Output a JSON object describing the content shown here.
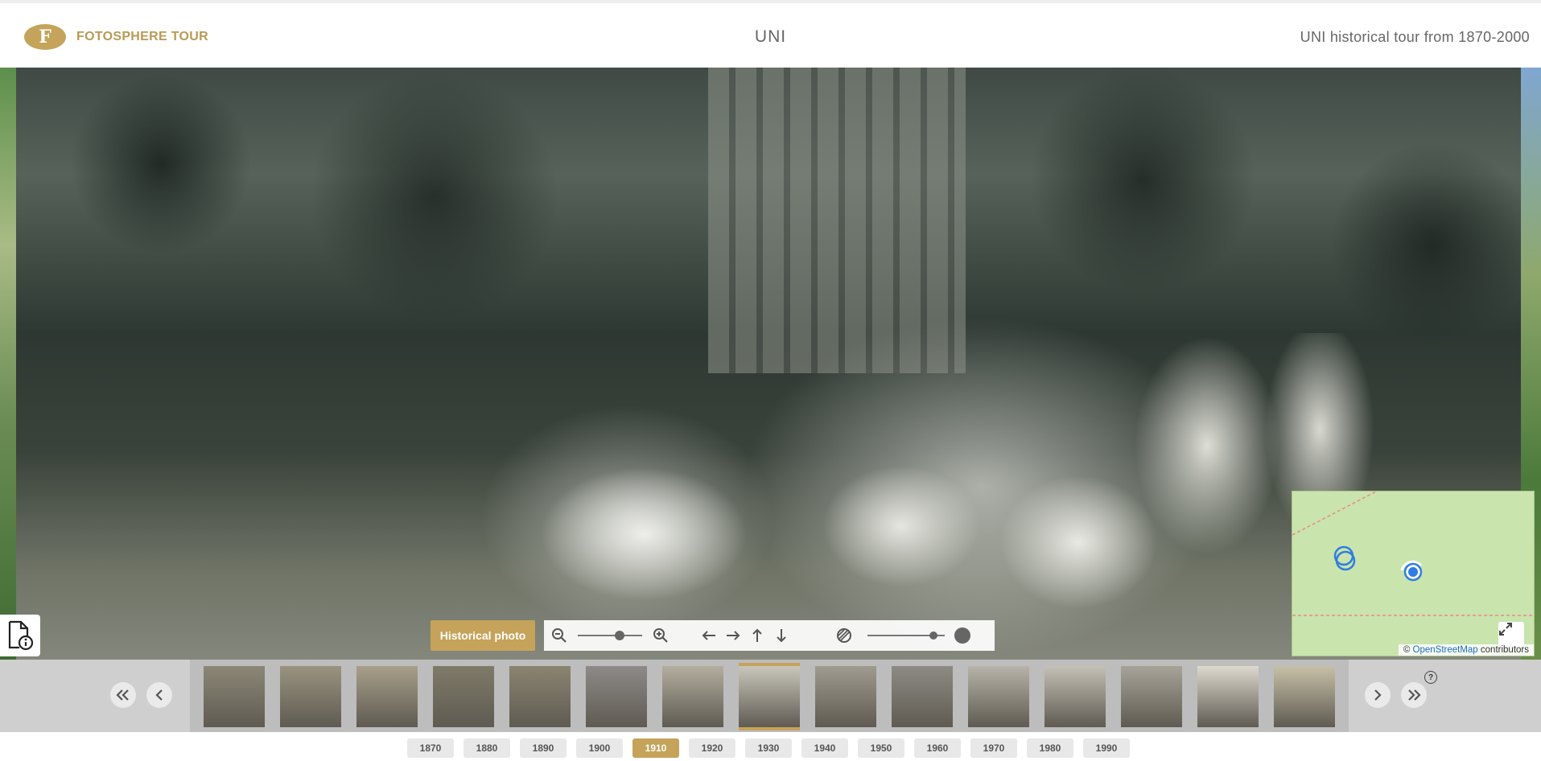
{
  "header": {
    "logo_letter": "F",
    "logo_text": "FOTOSPHERE TOUR",
    "title": "UNI",
    "subtitle": "UNI historical tour from 1870-2000"
  },
  "viewer": {
    "historical_button": "Historical photo",
    "zoom_level": 0.65,
    "opacity_level": 0.85
  },
  "map": {
    "attribution_prefix": "©",
    "attribution_link": "OpenStreetMap",
    "attribution_suffix": "contributors"
  },
  "timeline": {
    "thumbnails": [
      {
        "tone": "#8c8776"
      },
      {
        "tone": "#9a937f"
      },
      {
        "tone": "#a8a08a"
      },
      {
        "tone": "#7f7a68"
      },
      {
        "tone": "#8a8470"
      },
      {
        "tone": "#8d8a88"
      },
      {
        "tone": "#b3ae9f"
      },
      {
        "tone": "#c9c6bc"
      },
      {
        "tone": "#9f9b90"
      },
      {
        "tone": "#8d8b85"
      },
      {
        "tone": "#b7b3a9"
      },
      {
        "tone": "#c3c0b6"
      },
      {
        "tone": "#a7a398"
      },
      {
        "tone": "#ddd9cf"
      },
      {
        "tone": "#c7c0a8"
      }
    ],
    "active_index": 7,
    "decades": [
      "1870",
      "1880",
      "1890",
      "1900",
      "1910",
      "1920",
      "1930",
      "1940",
      "1950",
      "1960",
      "1970",
      "1980",
      "1990"
    ],
    "active_decade": "1910",
    "help_label": "?"
  },
  "colors": {
    "accent": "#c5a35a",
    "map_green": "#c9e4ad",
    "marker_blue": "#2f7de1"
  }
}
